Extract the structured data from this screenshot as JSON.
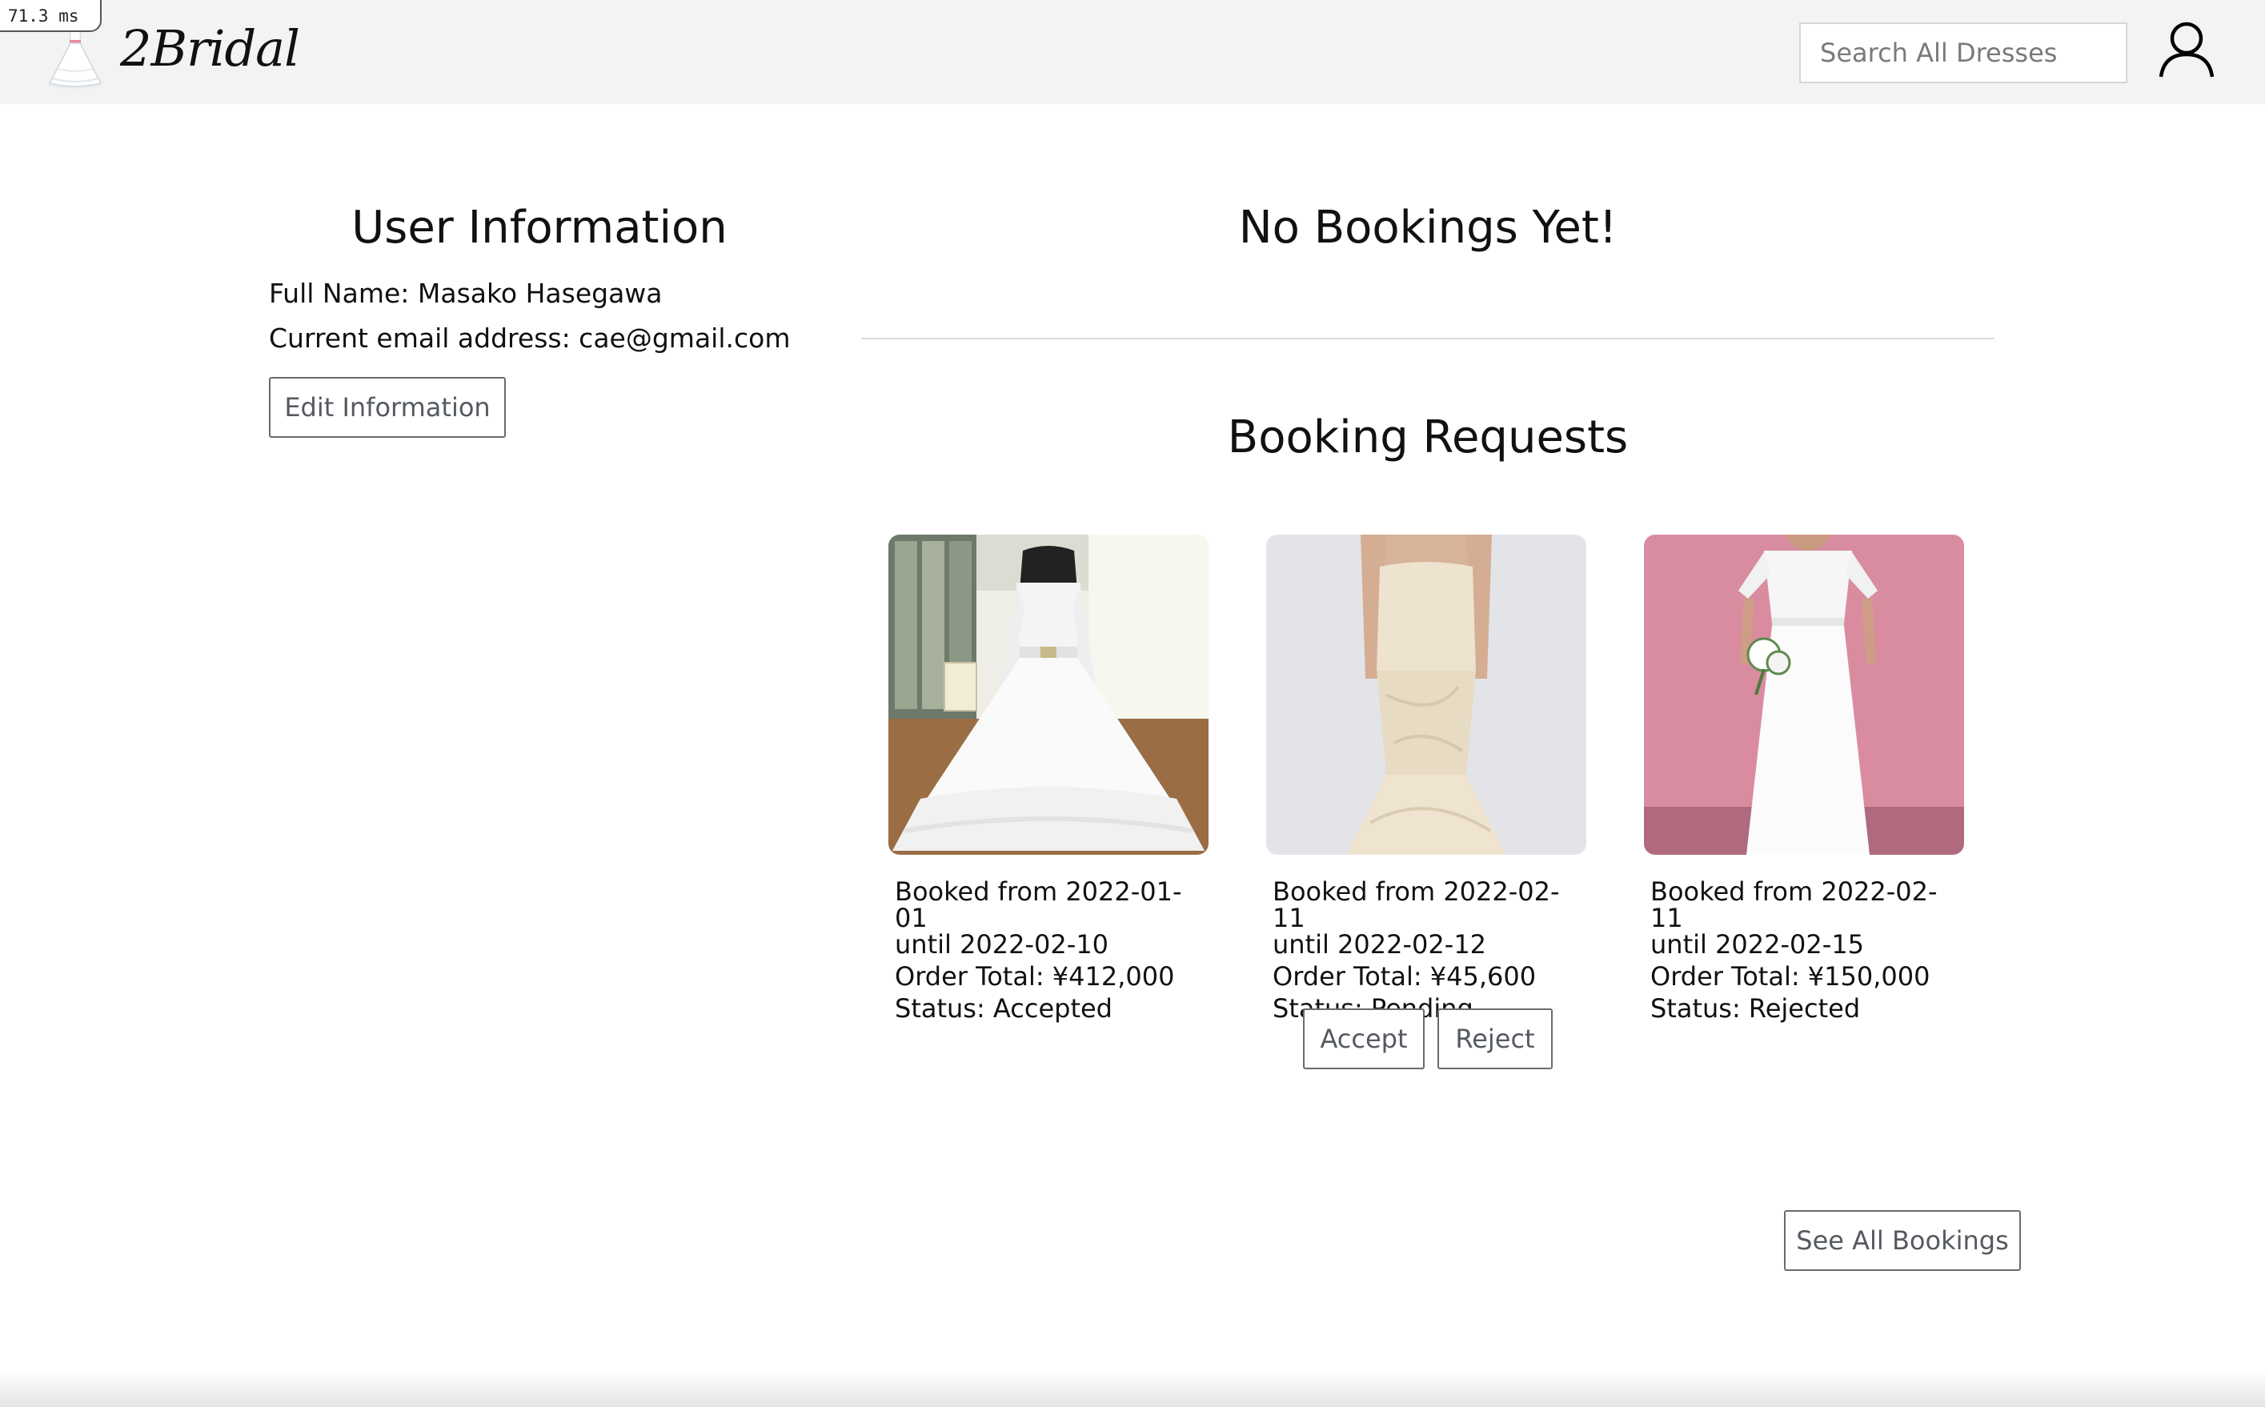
{
  "perf_badge": "71.3 ms",
  "header": {
    "brand": "2Bridal",
    "search_placeholder": "Search All Dresses",
    "logo_icon": "dress-logo-icon",
    "user_icon": "user-profile-icon"
  },
  "user_info": {
    "title": "User Information",
    "full_name_line": "Full Name: Masako Hasegawa",
    "email_line": "Current email address: cae@gmail.com",
    "edit_button": "Edit Information"
  },
  "bookings": {
    "title": "No Bookings Yet!"
  },
  "requests": {
    "title": "Booking Requests",
    "items": [
      {
        "image_icon": "lace-ballgown-dress-image",
        "booked_from": "Booked from 2022-01-01",
        "until": "until 2022-02-10",
        "total": "Order Total: ¥412,000",
        "status": "Status: Accepted"
      },
      {
        "image_icon": "satin-mermaid-dress-image",
        "booked_from": "Booked from 2022-02-11",
        "until": "until 2022-02-12",
        "total": "Order Total: ¥45,600",
        "status": "Status: Pending"
      },
      {
        "image_icon": "empire-waist-dress-image",
        "booked_from": "Booked from 2022-02-11",
        "until": "until 2022-02-15",
        "total": "Order Total: ¥150,000",
        "status": "Status: Rejected"
      }
    ],
    "accept_button": "Accept",
    "reject_button": "Reject",
    "see_all_button": "See All Bookings"
  },
  "colors": {
    "header_bg": "#f3f3f3",
    "button_border": "#6b6b6b",
    "button_text": "#555a60",
    "card3_bg": "#d98ca0"
  }
}
